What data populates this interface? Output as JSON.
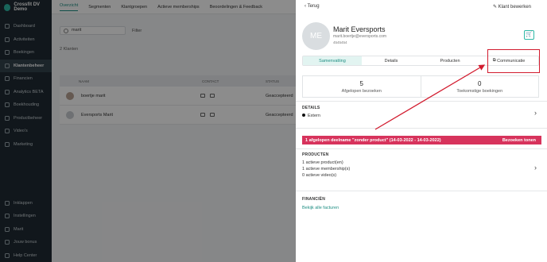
{
  "app": {
    "name": "Crossfit DV Demo"
  },
  "sidebar": {
    "items": [
      {
        "label": "Dashboard",
        "icon": "dashboard-icon"
      },
      {
        "label": "Activiteiten",
        "icon": "calendar-icon"
      },
      {
        "label": "Boekingen",
        "icon": "booking-icon"
      },
      {
        "label": "Klantenbeheer",
        "icon": "users-icon",
        "active": true
      },
      {
        "label": "Financien",
        "icon": "finance-icon"
      },
      {
        "label": "Analytics BETA",
        "icon": "analytics-icon"
      },
      {
        "label": "Boekhouding",
        "icon": "ledger-icon"
      },
      {
        "label": "Productbeheer",
        "icon": "product-icon"
      },
      {
        "label": "Video's",
        "icon": "video-icon"
      },
      {
        "label": "Marketing",
        "icon": "marketing-icon"
      }
    ],
    "bottom": [
      {
        "label": "Inklappen",
        "icon": "collapse-icon"
      },
      {
        "label": "Instellingen",
        "icon": "settings-icon"
      },
      {
        "label": "Marit",
        "icon": "user-icon"
      },
      {
        "label": "Jouw bonus",
        "icon": "heart-icon"
      },
      {
        "label": "Help Center",
        "icon": "help-icon"
      }
    ]
  },
  "background": {
    "tabs": [
      "Overzicht",
      "Segmenten",
      "Klantgroepen",
      "Actieve memberships",
      "Beoordelingen & Feedback"
    ],
    "search_value": "marit",
    "filter_label": "Filter",
    "count_label": "2 Klanten",
    "columns": [
      "NAAM",
      "CONTACT",
      "STATUS"
    ],
    "rows": [
      {
        "name": "boertje marit",
        "status": "Geaccepteerd"
      },
      {
        "name": "Eversports Marit",
        "status": "Geaccepteerd"
      }
    ]
  },
  "drawer": {
    "back_label": "Terug",
    "edit_label": "Klant bewerken",
    "initials": "ME",
    "name": "Marit Eversports",
    "email": "marit.boertje@eversports.com",
    "phone": "4545454",
    "tabs": [
      "Samenvatting",
      "Details",
      "Producten",
      "Communicatie"
    ],
    "stats": [
      {
        "value": "5",
        "label": "Afgelopen bezoeken"
      },
      {
        "value": "0",
        "label": "Toekomstige boekingen"
      }
    ],
    "details": {
      "title": "DETAILS",
      "line": "Extern"
    },
    "alert": {
      "text": "1 afgelopen deelname \"zonder product\" (14-03-2022 - 14-03-2022)",
      "action": "Bezoeken tonen"
    },
    "products": {
      "title": "PRODUCTEN",
      "lines": [
        "1 actieve product(en)",
        "1 actieve membership(s)",
        "0 actieve video(s)"
      ]
    },
    "finance": {
      "title": "FINANCIËN",
      "link": "Bekijk alle facturen"
    }
  },
  "colors": {
    "accent": "#1e8e83",
    "alert": "#d7335c",
    "highlight": "#d21b2e",
    "sidebar": "#1f2b33"
  }
}
